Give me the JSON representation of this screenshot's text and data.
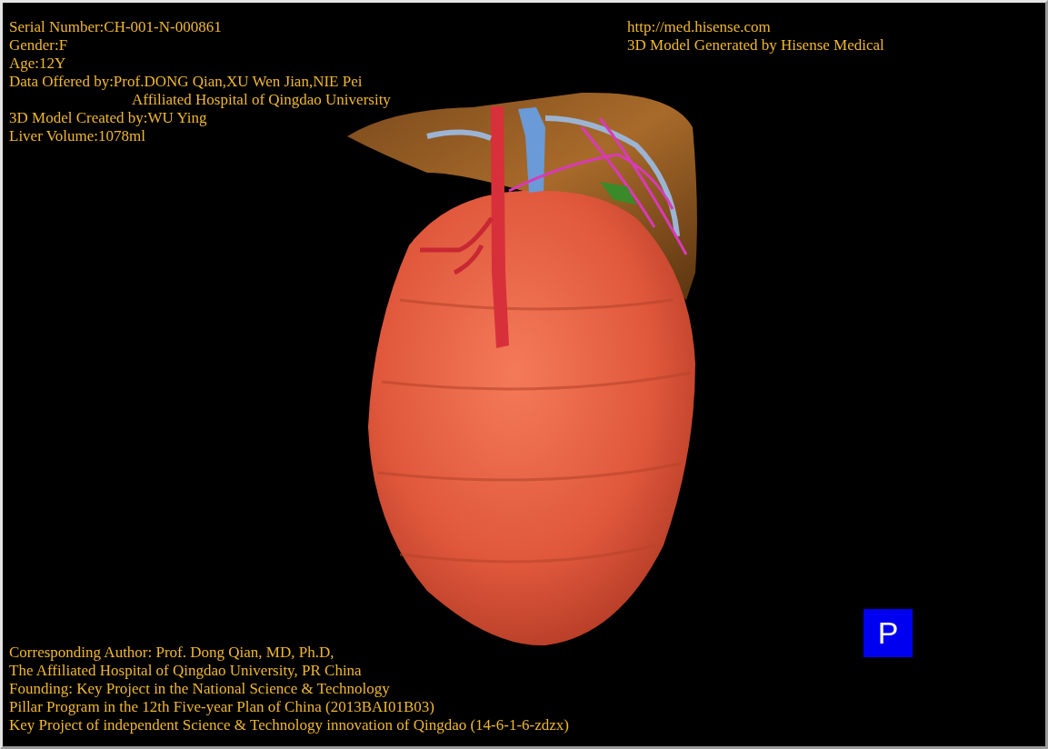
{
  "patient_info": [
    {
      "kind": "line",
      "text": "Serial Number:CH-001-N-000861"
    },
    {
      "kind": "line",
      "text": "Gender:F"
    },
    {
      "kind": "line",
      "text": "Age:12Y"
    },
    {
      "kind": "line",
      "text": "Data Offered by:Prof.DONG Qian,XU Wen Jian,NIE Pei"
    },
    {
      "kind": "continuation",
      "text": "Affiliated Hospital of Qingdao University"
    },
    {
      "kind": "line",
      "text": "3D Model Created by:WU Ying"
    },
    {
      "kind": "line",
      "text": "Liver Volume:1078ml"
    }
  ],
  "source_info": [
    "http://med.hisense.com",
    "3D Model Generated by Hisense Medical"
  ],
  "credits": [
    "Corresponding Author: Prof. Dong Qian, MD, Ph.D,",
    "The Affiliated Hospital of Qingdao University, PR China",
    "Founding: Key Project in the National Science & Technology",
    "Pillar Program in the 12th Five-year Plan of China (2013BAI01B03)",
    "Key Project of independent Science & Technology innovation of Qingdao (14-6-1-6-zdzx)"
  ],
  "orientation_marker": "P"
}
